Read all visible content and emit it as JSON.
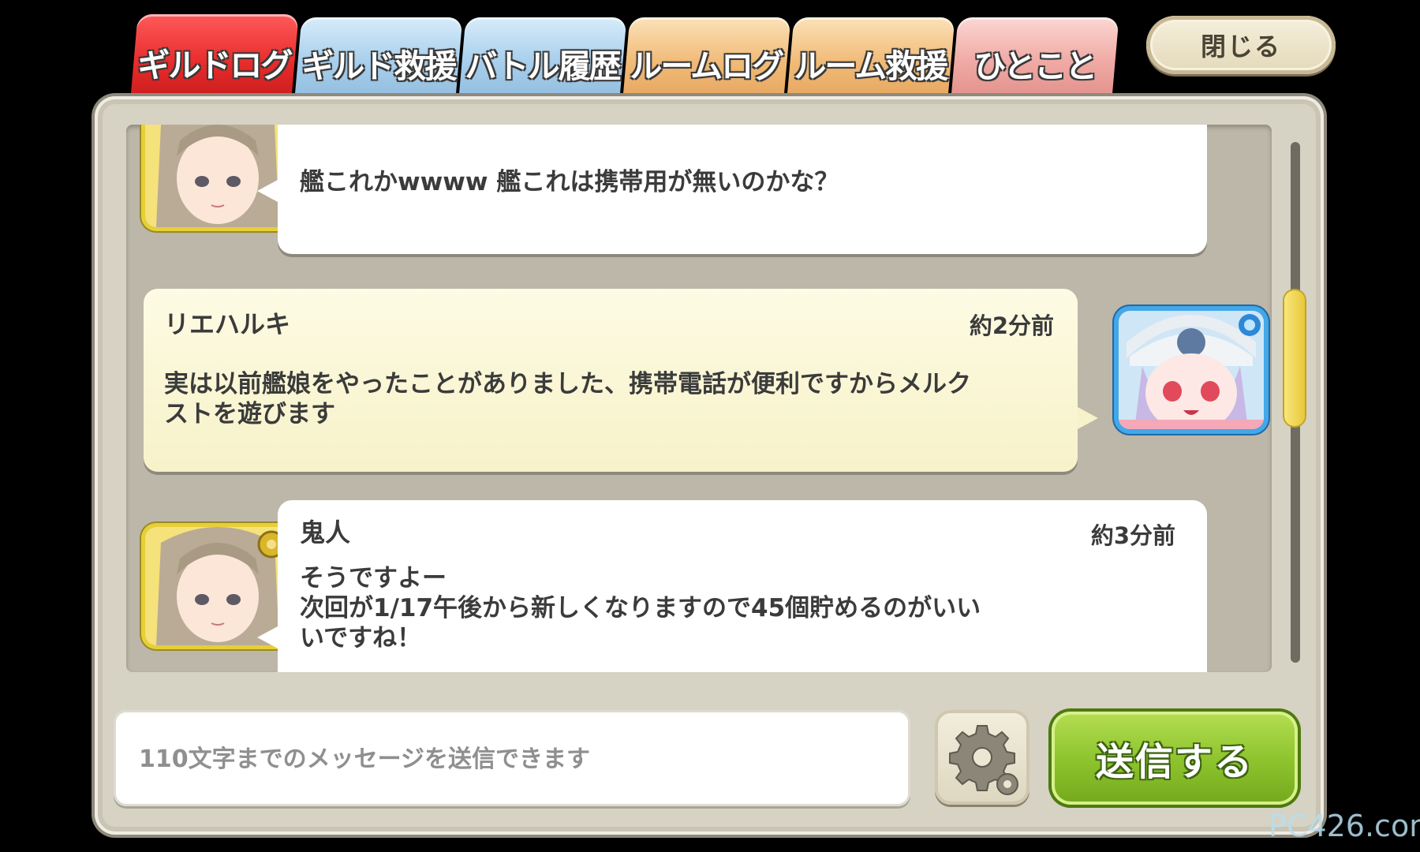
{
  "tabs": [
    {
      "label": "ギルドログ",
      "active": true,
      "color": "#e72a2a"
    },
    {
      "label": "ギルド救援",
      "active": false,
      "color": "#a8cfec"
    },
    {
      "label": "バトル履歴",
      "active": false,
      "color": "#a8cfec"
    },
    {
      "label": "ルームログ",
      "active": false,
      "color": "#f1bb78"
    },
    {
      "label": "ルーム救援",
      "active": false,
      "color": "#f1bb78"
    },
    {
      "label": "ひとこと",
      "active": false,
      "color": "#f0aaa5"
    }
  ],
  "close_label": "閉じる",
  "messages": [
    {
      "name": "",
      "time": "",
      "text": "艦これかwwww 艦これは携帯用が無いのかな？",
      "avatar": "girl-portrait-icon"
    },
    {
      "name": "リエハルキ",
      "time": "約2分前",
      "text": "実は以前艦娘をやったことがありました、携帯電話が便利ですからメルク\nストを遊びます",
      "avatar": "cap-girl-portrait-icon"
    },
    {
      "name": "鬼人",
      "time": "約3分前",
      "text": "そうですよー\n次回が1/17午後から新しくなりますので45個貯めるのがいい\nいですね！",
      "avatar": "girl-portrait-icon"
    }
  ],
  "input": {
    "placeholder": "110文字までのメッセージを送信できます",
    "value": ""
  },
  "settings_icon": "gear-icon",
  "send_label": "送信する",
  "watermark": "PC426.com",
  "colors": {
    "accent_red": "#e72a2a",
    "send_green": "#8cc22c",
    "scroll_yellow": "#f9e77a"
  }
}
